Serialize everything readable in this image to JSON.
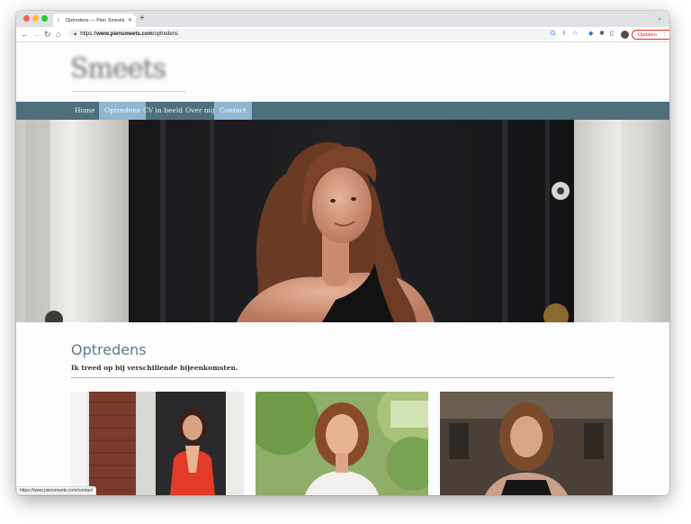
{
  "browser": {
    "tab_title": "Optredens — Pien Smeets Sop...",
    "url_prefix": "https://",
    "url_domain": "www.piensmeets.com",
    "url_path": "/optredens",
    "update_label": "Updaten",
    "status_url": "https://www.piensmeets.com/contact"
  },
  "site": {
    "logo_text": "Smeets",
    "nav": [
      "Home",
      "Optredens",
      "CV in beeld",
      "Over mij",
      "Contact"
    ],
    "active_nav": [
      "Optredens",
      "Contact"
    ],
    "section_title": "Optredens",
    "section_subtitle": "Ik treed op bij verschillende bijeenkomsten."
  },
  "colors": {
    "nav_bar": "#4f6f7b",
    "nav_active": "#8fb7cf",
    "title": "#5a7c8c",
    "update": "#d93025"
  },
  "icons": [
    "back-icon",
    "forward-icon",
    "reload-icon",
    "home-icon",
    "lock-icon",
    "google-icon",
    "share-icon",
    "star-icon",
    "extension-icon",
    "puzzle-icon",
    "sidebar-icon",
    "menu-icon"
  ]
}
